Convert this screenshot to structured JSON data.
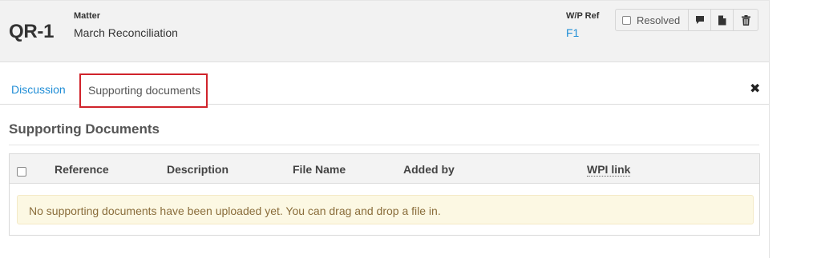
{
  "header": {
    "code": "QR-1",
    "matter_label": "Matter",
    "matter_value": "March Reconciliation",
    "wp_ref_label": "W/P Ref",
    "wp_ref_value": "F1",
    "resolved_label": "Resolved",
    "resolved_checked": false,
    "icons": [
      "comment-icon",
      "document-icon",
      "trash-icon"
    ]
  },
  "tabs": {
    "discussion": "Discussion",
    "supporting": "Supporting documents",
    "active": "supporting"
  },
  "section": {
    "title": "Supporting Documents"
  },
  "table": {
    "columns": [
      "Reference",
      "Description",
      "File Name",
      "Added by",
      "WPI link"
    ],
    "empty_message": "No supporting documents have been uploaded yet. You can drag and drop a file in."
  },
  "colors": {
    "link": "#1f8dd6",
    "highlight_border": "#d0232b",
    "empty_bg": "#fcf8e3",
    "empty_text": "#8a6d3b"
  }
}
